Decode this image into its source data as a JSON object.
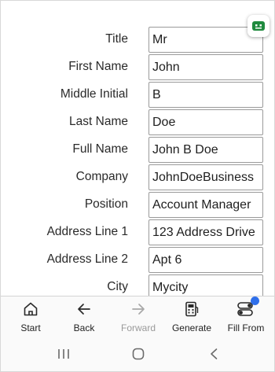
{
  "form": {
    "rows": [
      {
        "label": "Title",
        "value": "Mr"
      },
      {
        "label": "First Name",
        "value": "John"
      },
      {
        "label": "Middle Initial",
        "value": "B"
      },
      {
        "label": "Last Name",
        "value": "Doe"
      },
      {
        "label": "Full Name",
        "value": "John B Doe"
      },
      {
        "label": "Company",
        "value": "JohnDoeBusiness"
      },
      {
        "label": "Position",
        "value": "Account Manager"
      },
      {
        "label": "Address Line 1",
        "value": "123 Address Drive"
      },
      {
        "label": "Address Line 2",
        "value": "Apt 6"
      },
      {
        "label": "City",
        "value": "Mycity"
      }
    ]
  },
  "badge": {
    "icon": "robot-face-icon",
    "color": "#1f8a3e"
  },
  "toolbar": {
    "items": [
      {
        "label": "Start",
        "icon": "home-icon",
        "enabled": true
      },
      {
        "label": "Back",
        "icon": "arrow-left-icon",
        "enabled": true
      },
      {
        "label": "Forward",
        "icon": "arrow-right-icon",
        "enabled": false
      },
      {
        "label": "Generate",
        "icon": "password-generator-icon",
        "enabled": true
      },
      {
        "label": "Fill From",
        "icon": "toggles-icon",
        "enabled": true,
        "notification_color": "#2f6fea"
      }
    ]
  },
  "system_nav": {
    "items": [
      "recents-icon",
      "home-icon",
      "back-icon"
    ]
  }
}
